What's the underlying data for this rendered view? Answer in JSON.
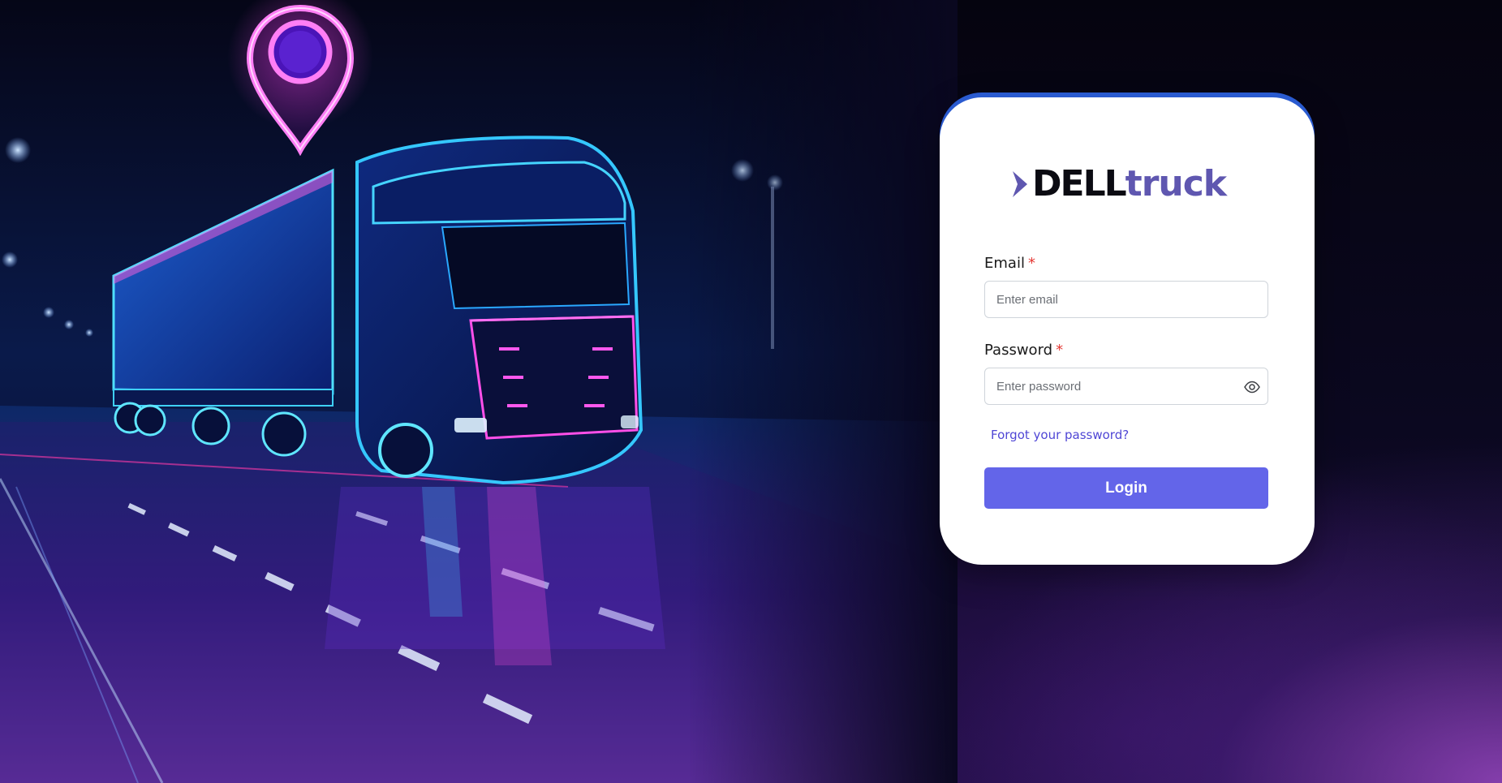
{
  "brand": {
    "name_part1": "DELL",
    "name_part2": "truck",
    "primary_color": "#5f57b0",
    "accent_color": "#6365e9"
  },
  "login_form": {
    "email_label": "Email",
    "email_required_mark": "*",
    "email_placeholder": "Enter email",
    "email_value": "",
    "password_label": "Password",
    "password_required_mark": "*",
    "password_placeholder": "Enter password",
    "password_value": "",
    "password_toggle_icon": "eye-icon",
    "forgot_link": "Forgot your password?",
    "submit_label": "Login"
  },
  "hero": {
    "icons": [
      "map-pin-icon",
      "truck-illustration"
    ]
  }
}
